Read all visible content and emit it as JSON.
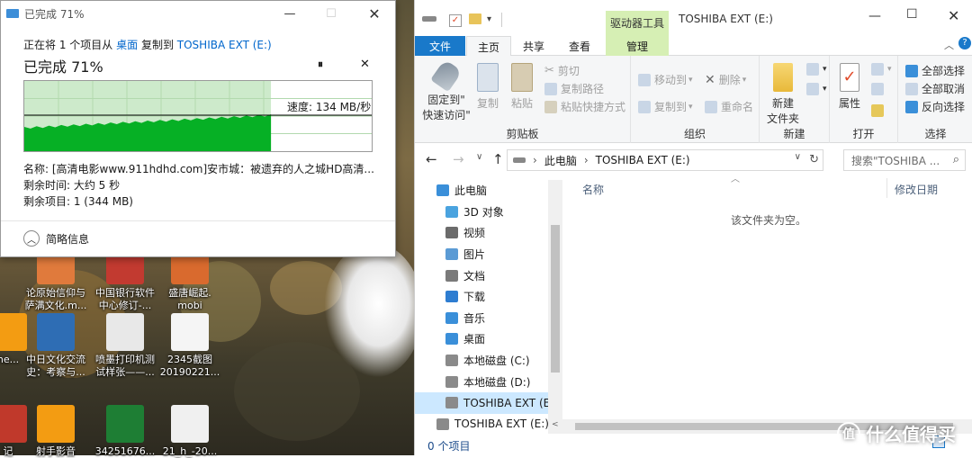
{
  "desktop": {
    "icons": [
      {
        "label": "论原始信仰与萨满文化.mobi",
        "line1": "论原始信仰与",
        "line2": "萨满文化.m...",
        "color": "#e07a3c"
      },
      {
        "label": "中国银行软件中心修订",
        "line1": "中国银行软件",
        "line2": "中心修订-...",
        "color": "#c23a30"
      },
      {
        "label": "盛唐崛起.mobi",
        "line1": "盛唐崛起.",
        "line2": "mobi",
        "color": "#d96a2e"
      },
      {
        "label": "ne...",
        "line1": "ne...",
        "line2": "",
        "color": "#f39c12"
      },
      {
        "label": "中日文化交流史",
        "line1": "中日文化交流",
        "line2": "史：考察与...",
        "color": "#2e6db4"
      },
      {
        "label": "喷墨打印机测试样张",
        "line1": "喷墨打印机测",
        "line2": "试样张——...",
        "color": "#e8e8e8"
      },
      {
        "label": "2345截图20190221",
        "line1": "2345截图",
        "line2": "20190221...",
        "color": "#f5f5f5"
      },
      {
        "label": "记",
        "line1": "记",
        "line2": "",
        "color": "#c0392b"
      },
      {
        "label": "射手影音",
        "line1": "射手影音",
        "line2": "",
        "color": "#f39c12"
      },
      {
        "label": "34251676",
        "line1": "34251676...",
        "line2": "",
        "color": "#1e7e34"
      },
      {
        "label": "21_h_20",
        "line1": "21_h_-20...",
        "line2": "",
        "color": "#f0f0f0"
      }
    ]
  },
  "copy_dialog": {
    "title": "已完成 71%",
    "copy_prefix": "正在将 1 个项目从",
    "source": "桌面",
    "copy_mid": "复制到",
    "destination": "TOSHIBA EXT (E:)",
    "progress_heading": "已完成 71%",
    "progress_fraction": 0.71,
    "speed_text": "速度: 134 MB/秒",
    "name_label": "名称: ",
    "name_value": "[高清电影www.911hdhd.com]安市城：被遗弃的人之城HD高清...",
    "time_left_label": "剩余时间: ",
    "time_left_value": "大约 5 秒",
    "items_left_label": "剩余项目: ",
    "items_left_value": "1 (344 MB)",
    "fewer_details": "简略信息",
    "pause_glyph": "⏸",
    "close_glyph": "✕",
    "accent_color": "#06b025"
  },
  "explorer": {
    "title": "TOSHIBA EXT (E:)",
    "context_tab": "驱动器工具",
    "tabs": [
      "文件",
      "主页",
      "共享",
      "查看",
      "管理"
    ],
    "groups": {
      "clipboard": {
        "label": "剪贴板",
        "pin": "固定到\"快速访问\"",
        "pin1": "固定到\"",
        "pin2": "快速访问\"",
        "copy": "复制",
        "paste": "粘贴",
        "cut": "剪切",
        "copy_path": "复制路径",
        "paste_shortcut": "粘贴快捷方式"
      },
      "organize": {
        "label": "组织",
        "move_to": "移动到",
        "copy_to": "复制到",
        "delete": "删除",
        "rename": "重命名"
      },
      "new": {
        "label": "新建",
        "new_folder": "新建\n文件夹",
        "nf1": "新建",
        "nf2": "文件夹"
      },
      "open": {
        "label": "打开",
        "properties": "属性"
      },
      "select": {
        "label": "选择",
        "select_all": "全部选择",
        "select_none": "全部取消",
        "invert": "反向选择"
      }
    },
    "address_path": [
      "此电脑",
      "TOSHIBA EXT (E:)"
    ],
    "search_placeholder": "搜索\"TOSHIBA ...",
    "nav_tree": [
      {
        "label": "此电脑",
        "color": "#3a8fd9",
        "indent": 0
      },
      {
        "label": "3D 对象",
        "color": "#4aa3df",
        "indent": 1
      },
      {
        "label": "视频",
        "color": "#6b6b6b",
        "indent": 1
      },
      {
        "label": "图片",
        "color": "#5b9bd5",
        "indent": 1
      },
      {
        "label": "文档",
        "color": "#7a7a7a",
        "indent": 1
      },
      {
        "label": "下载",
        "color": "#2e7dd1",
        "indent": 1
      },
      {
        "label": "音乐",
        "color": "#3a8fd9",
        "indent": 1
      },
      {
        "label": "桌面",
        "color": "#3a8fd9",
        "indent": 1
      },
      {
        "label": "本地磁盘 (C:)",
        "color": "#8a8a8a",
        "indent": 1
      },
      {
        "label": "本地磁盘 (D:)",
        "color": "#8a8a8a",
        "indent": 1
      },
      {
        "label": "TOSHIBA EXT (E:)",
        "color": "#8a8a8a",
        "indent": 1,
        "selected": true
      },
      {
        "label": "TOSHIBA EXT (E:)",
        "color": "#8a8a8a",
        "indent": 0
      }
    ],
    "columns": {
      "name": "名称",
      "modified": "修改日期"
    },
    "empty_message": "该文件夹为空。",
    "status_text": "0 个项目",
    "accent_color": "#1979ca",
    "context_color": "#d6efb4"
  },
  "watermark": {
    "logo_glyph": "值",
    "text": "什么值得买"
  }
}
